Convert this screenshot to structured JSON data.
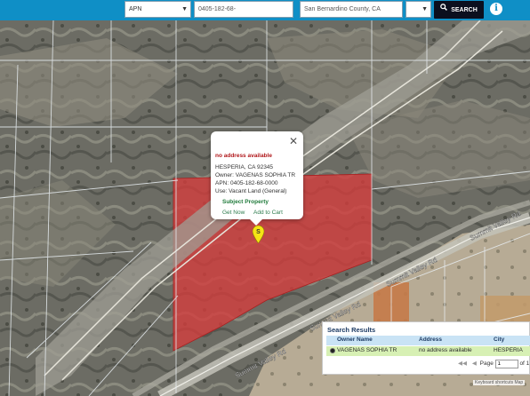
{
  "toolbar": {
    "search_type": "APN",
    "apn_value": "0405-182-68-",
    "location_value": "San Bernardino County, CA",
    "extra_select": "",
    "search_label": "SEARCH",
    "info_icon": "info-icon"
  },
  "map": {
    "parcel_color": "#d63c3c",
    "roads": [
      "Summit Valley Rd",
      "Summit Valley Rd",
      "Summit Valley Rd"
    ],
    "pin_label": "S",
    "attribution": "Keyboard shortcuts  Map"
  },
  "popup": {
    "title": "no address available",
    "city_line": "HESPERIA, CA 92345",
    "owner_line": "Owner: VAGENAS SOPHIA TR",
    "apn_line": "APN: 0405-182-68-0000",
    "use_line": "Use: Vacant Land (General)",
    "subject_label": "Subject Property",
    "get_now_label": "Get Now",
    "add_to_cart_label": "Add to Cart"
  },
  "results": {
    "heading": "Search Results",
    "columns": [
      "Owner Name",
      "Address",
      "City"
    ],
    "rows": [
      {
        "owner": "VAGENAS SOPHIA TR",
        "address": "no address available",
        "city": "HESPERIA"
      }
    ],
    "page_label": "Page",
    "page_value": "1",
    "of_label": "of 1"
  }
}
